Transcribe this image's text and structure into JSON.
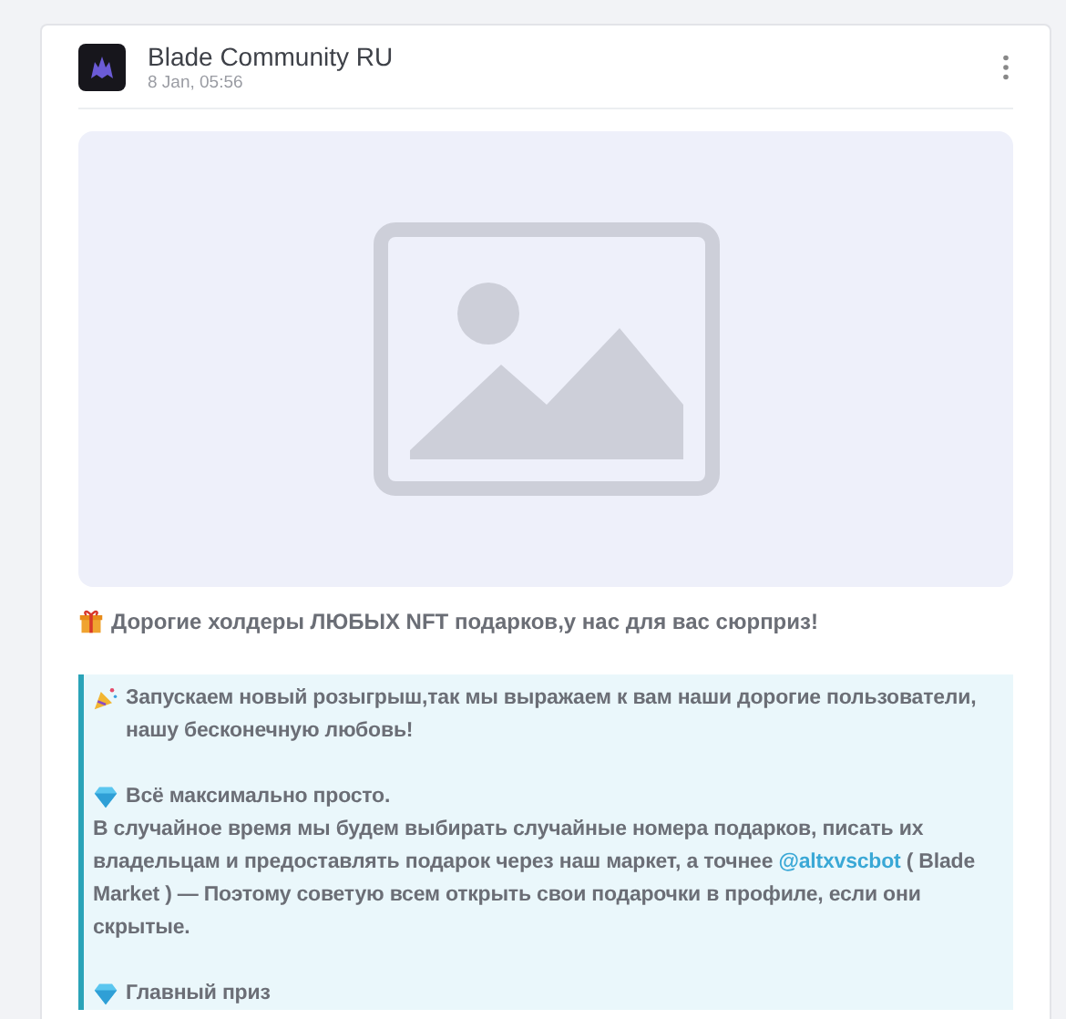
{
  "post": {
    "channel": "Blade Community RU",
    "date": "8 Jan, 05:56",
    "media": {
      "kind": "placeholder"
    },
    "headline": {
      "kind": "gift",
      "text": "Дорогие холдеры ЛЮБЫХ NFT подарков,у нас для вас сюрприз!"
    },
    "quote": [
      [
        {
          "kind": "party",
          "text": "Запускаем новый розыгрыш,так мы выражаем к вам наши дорогие пользователи, нашу бесконечную любовь!"
        }
      ],
      [
        {
          "kind": "diamond",
          "text": "Всё максимально просто."
        },
        {
          "text": "В случайное время мы будем выбирать случайные номера подарков, писать их владельцам и предоставлять подарок через наш маркет, а точнее ",
          "link": "@altxvscbot",
          "after": " ( Blade Market ) — Поэтому советую всем открыть свои подарочки в профиле, если они скрытые."
        }
      ],
      [
        {
          "kind": "diamond",
          "text": "Главный приз"
        }
      ]
    ]
  }
}
